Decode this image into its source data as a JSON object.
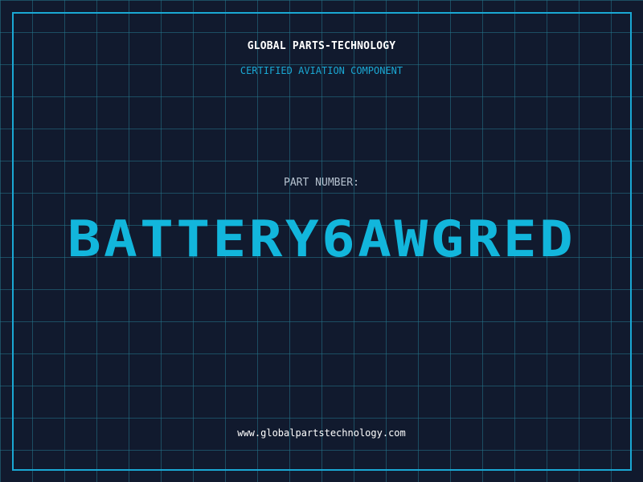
{
  "header": {
    "company": "GLOBAL PARTS-TECHNOLOGY",
    "subtitle": "CERTIFIED AVIATION COMPONENT"
  },
  "part": {
    "label": "PART NUMBER:",
    "number": "BATTERY6AWGRED"
  },
  "footer": {
    "website": "www.globalpartstechnology.com"
  },
  "colors": {
    "background": "#111a2e",
    "grid": "#24768c",
    "accent": "#1aa8d4",
    "part_number": "#12b6dc",
    "label": "#b7c3d0",
    "text": "#ffffff"
  }
}
